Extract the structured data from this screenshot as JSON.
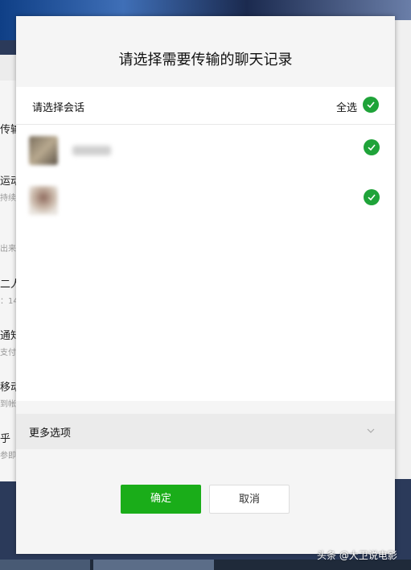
{
  "background": {
    "left_items": [
      {
        "title": "传输",
        "sub": ""
      },
      {
        "title": "运动",
        "sub": "持续"
      },
      {
        "title": "",
        "sub": "出来"
      },
      {
        "title": "二人",
        "sub": "：14"
      },
      {
        "title": "通知",
        "sub": "支付"
      },
      {
        "title": "移动",
        "sub": "到帐"
      },
      {
        "title": "乎",
        "sub": "参即"
      }
    ]
  },
  "dialog": {
    "title": "请选择需要传输的聊天记录",
    "select_label": "请选择会话",
    "select_all_label": "全选",
    "more_options_label": "更多选项",
    "confirm_label": "确定",
    "cancel_label": "取消"
  },
  "watermark": "头条 @大卫说电影",
  "colors": {
    "accent_green": "#1aad19",
    "check_green": "#1fa339"
  },
  "icons": {
    "check": "check-icon",
    "chevron": "chevron-down-icon"
  }
}
